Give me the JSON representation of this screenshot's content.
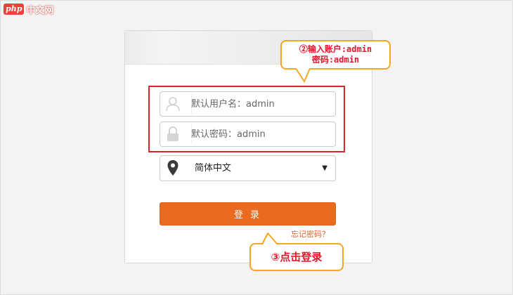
{
  "watermark": {
    "badge": "php",
    "text": "中文网"
  },
  "login": {
    "username_placeholder": "默认用户名：admin",
    "password_placeholder": "默认密码：admin",
    "language_value": "简体中文",
    "submit_label": "登 录",
    "forgot_label": "忘记密码？"
  },
  "annotations": {
    "step2_line1": "②输入账户:admin",
    "step2_line2": "密码:admin",
    "step3": "③点击登录"
  },
  "colors": {
    "accent": "#ea6b1f",
    "highlight": "#d7262d",
    "callout_border": "#f5a623",
    "callout_text": "#e8152a"
  },
  "icons": {
    "username": "user-icon",
    "password": "lock-icon",
    "language": "map-pin-icon",
    "dropdown": "caret-down-icon"
  }
}
